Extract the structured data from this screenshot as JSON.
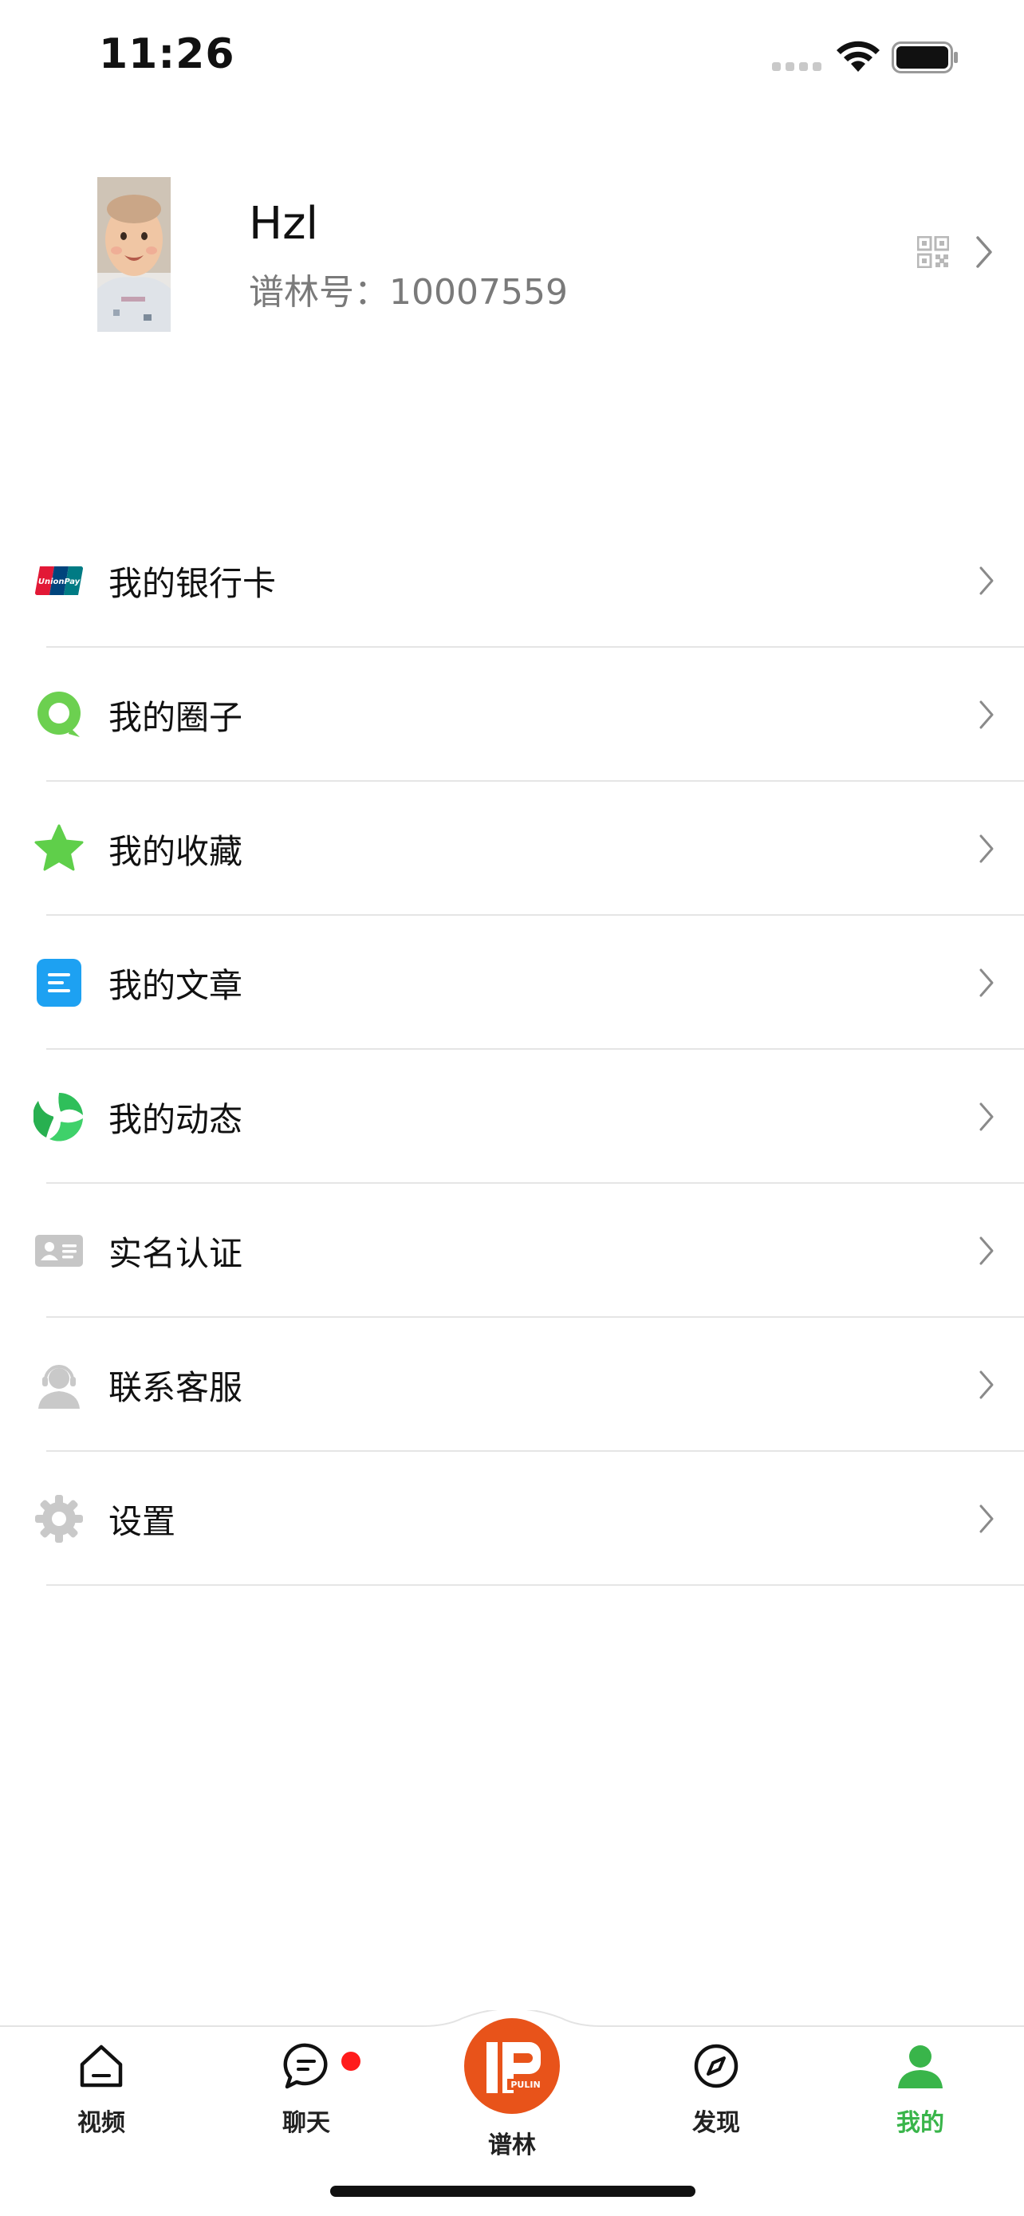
{
  "status_bar": {
    "time": "11:26"
  },
  "profile": {
    "name": "Hzl",
    "id_label": "谱林号：",
    "id_value": "10007559"
  },
  "menu": {
    "items": [
      {
        "label": "我的银行卡",
        "icon": "unionpay-card-icon"
      },
      {
        "label": "我的圈子",
        "icon": "circle-chat-icon"
      },
      {
        "label": "我的收藏",
        "icon": "star-icon"
      },
      {
        "label": "我的文章",
        "icon": "article-icon"
      },
      {
        "label": "我的动态",
        "icon": "moments-icon"
      },
      {
        "label": "实名认证",
        "icon": "id-card-icon"
      },
      {
        "label": "联系客服",
        "icon": "customer-service-icon"
      },
      {
        "label": "设置",
        "icon": "gear-icon"
      }
    ]
  },
  "tab_bar": {
    "video": "视频",
    "chat": "聊天",
    "center": "谱林",
    "discover": "发现",
    "mine": "我的",
    "active": "mine"
  },
  "colors": {
    "accent_green": "#39b54a",
    "brand_orange": "#e8531a",
    "badge_red": "#ff1b1b"
  }
}
